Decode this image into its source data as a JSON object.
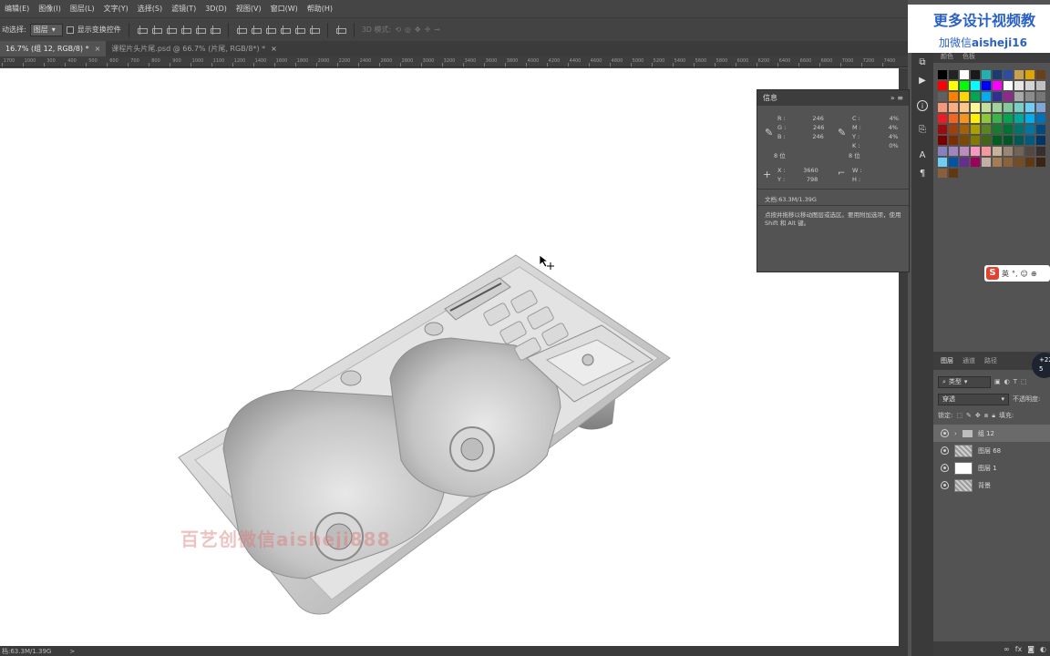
{
  "menu": [
    "编辑(E)",
    "图像(I)",
    "图层(L)",
    "文字(Y)",
    "选择(S)",
    "滤镜(T)",
    "3D(D)",
    "视图(V)",
    "窗口(W)",
    "帮助(H)"
  ],
  "options": {
    "auto_select_label": "动选择:",
    "auto_select_value": "图层",
    "show_transform_label": "显示变换控件",
    "mode_3d_label": "3D 模式:"
  },
  "tabs": [
    {
      "label": "16.7% (组 12, RGB/8) *",
      "close": "×",
      "active": true
    },
    {
      "label": "课程片头片尾.psd @ 66.7% (片尾, RGB/8*) *",
      "close": "×",
      "active": false
    }
  ],
  "ruler": {
    "ticks": [
      "1700",
      "1000",
      "300",
      "400",
      "500",
      "600",
      "700",
      "800",
      "900",
      "1000",
      "1100",
      "1200",
      "1400",
      "1600",
      "1800",
      "2000",
      "2200",
      "2400",
      "2600",
      "2800",
      "3000",
      "3200",
      "3400",
      "3600",
      "3800",
      "4000",
      "4200",
      "4400",
      "4600",
      "4800",
      "5000",
      "5200",
      "5400",
      "5600",
      "5800",
      "6000",
      "6200",
      "6400",
      "6600",
      "6800",
      "7000",
      "7200",
      "7400"
    ]
  },
  "canvas": {
    "watermark": "百艺创微信aisheji888"
  },
  "info_panel": {
    "title": "信息",
    "rgb": {
      "R": "246",
      "G": "246",
      "B": "246"
    },
    "cmyk": {
      "C": "4%",
      "M": "4%",
      "Y": "4%",
      "K": "0%"
    },
    "bits_left": "8 位",
    "bits_right": "8 位",
    "pos": {
      "X": "3660",
      "Y": "798"
    },
    "size": {
      "W": "",
      "H": ""
    },
    "doc": "文档:63.3M/1.39G",
    "hint": "点按并拖移以移动图层或选区。要用附加选项，使用 Shift 和 Alt 键。"
  },
  "status": {
    "doc": "档:63.3M/1.39G",
    "arrow": ">"
  },
  "swatches": {
    "tabs": [
      "颜色",
      "色板"
    ],
    "rows": [
      [
        "#000000",
        "#232323",
        "#ffffff",
        "#1a1a1a",
        "#22b0b3",
        "#1d3b73",
        "#2d4da0",
        "#c7a14b",
        "#e0a500",
        "#6a3f1a"
      ],
      [
        "#ff0000",
        "#ffff00",
        "#00ff00",
        "#00ffff",
        "#0000ff",
        "#ff00ff",
        "#ffffff",
        "#e6e6e6",
        "#d4d4d4",
        "#c0c0c0"
      ],
      [
        "#606060",
        "#ff8000",
        "#ffd700",
        "#00a651",
        "#00aeef",
        "#2e3192",
        "#92278f",
        "#a8a8a8",
        "#8c8c8c",
        "#767676"
      ],
      [
        "#f7977a",
        "#f9ad81",
        "#fdc68a",
        "#fff79a",
        "#c4df9b",
        "#a3d39c",
        "#82ca9d",
        "#7bcdc8",
        "#6ecff6",
        "#7ea7d8"
      ],
      [
        "#ed1c24",
        "#f26522",
        "#f7941d",
        "#fff200",
        "#8dc73f",
        "#39b54a",
        "#00a651",
        "#00a99d",
        "#00aeef",
        "#0072bc"
      ],
      [
        "#9e0b0f",
        "#a0410d",
        "#a36209",
        "#aba000",
        "#598527",
        "#197b30",
        "#007236",
        "#00746b",
        "#0076a3",
        "#004a80"
      ],
      [
        "#790000",
        "#7b2e00",
        "#7d4900",
        "#827b00",
        "#406618",
        "#005e20",
        "#005826",
        "#005952",
        "#005b7f",
        "#003663"
      ],
      [
        "#8781bd",
        "#a186be",
        "#bd8cbf",
        "#f49ac1",
        "#f5989d",
        "#c7b299",
        "#998675",
        "#736357",
        "#534741",
        "#362f2d"
      ],
      [
        "#6dcff6",
        "#0054a6",
        "#662d91",
        "#9e005d",
        "#c4b0a2",
        "#a67c52",
        "#8c6239",
        "#754c24",
        "#603913",
        "#3c2415"
      ],
      [
        "#8b5e3c",
        "#603913"
      ]
    ]
  },
  "ime": {
    "label": "英",
    "extra": "°,"
  },
  "layers_panel": {
    "tabs": [
      "图层",
      "通道",
      "路径"
    ],
    "filter": "类型",
    "blend": "穿透",
    "opacity_label": "不透明度:",
    "lock_label": "锁定:",
    "fill_label": "填充:",
    "layers": [
      {
        "name": "组 12",
        "kind": "group"
      },
      {
        "name": "图层 68",
        "kind": "pattern"
      },
      {
        "name": "图层 1",
        "kind": "white"
      },
      {
        "name": "背景",
        "kind": "pattern"
      }
    ],
    "footer_fx": "fx"
  },
  "promo": {
    "line1": "更多设计视频教",
    "line2_prefix": "加微信",
    "line2_id": "aisheji16"
  },
  "zoom_badge": {
    "line1": "+22",
    "line2": "5"
  },
  "colors": {
    "app_bg": "#535353",
    "canvas_bg": "#ffffff",
    "promo_blue": "#2b61c6",
    "watermark": "#dc7878"
  }
}
